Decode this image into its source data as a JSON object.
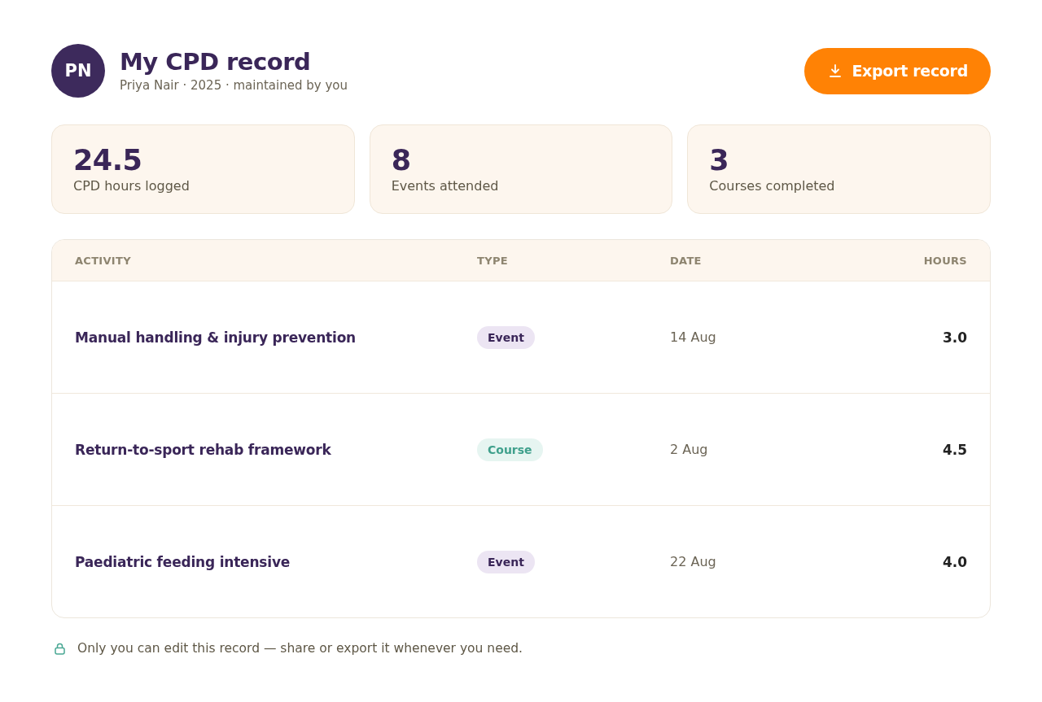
{
  "header": {
    "avatar_initials": "PN",
    "title": "My CPD record",
    "subtitle": "Priya Nair · 2025 · maintained by you",
    "export_button": "Export record"
  },
  "stats": [
    {
      "value": "24.5",
      "label": "CPD hours logged"
    },
    {
      "value": "8",
      "label": "Events attended"
    },
    {
      "value": "3",
      "label": "Courses completed"
    }
  ],
  "table": {
    "columns": [
      "ACTIVITY",
      "TYPE",
      "DATE",
      "HOURS"
    ],
    "rows": [
      {
        "activity": "Manual handling & injury prevention",
        "type": {
          "kind": "event",
          "label": "Event"
        },
        "date": "14 Aug",
        "hours": "3.0"
      },
      {
        "activity": "Return-to-sport rehab framework",
        "type": {
          "kind": "course",
          "label": "Course"
        },
        "date": "2 Aug",
        "hours": "4.5"
      },
      {
        "activity": "Paediatric feeding intensive",
        "type": {
          "kind": "event",
          "label": "Event"
        },
        "date": "22 Aug",
        "hours": "4.0"
      }
    ]
  },
  "footer_note": "Only you can edit this record — share or export it whenever you need."
}
